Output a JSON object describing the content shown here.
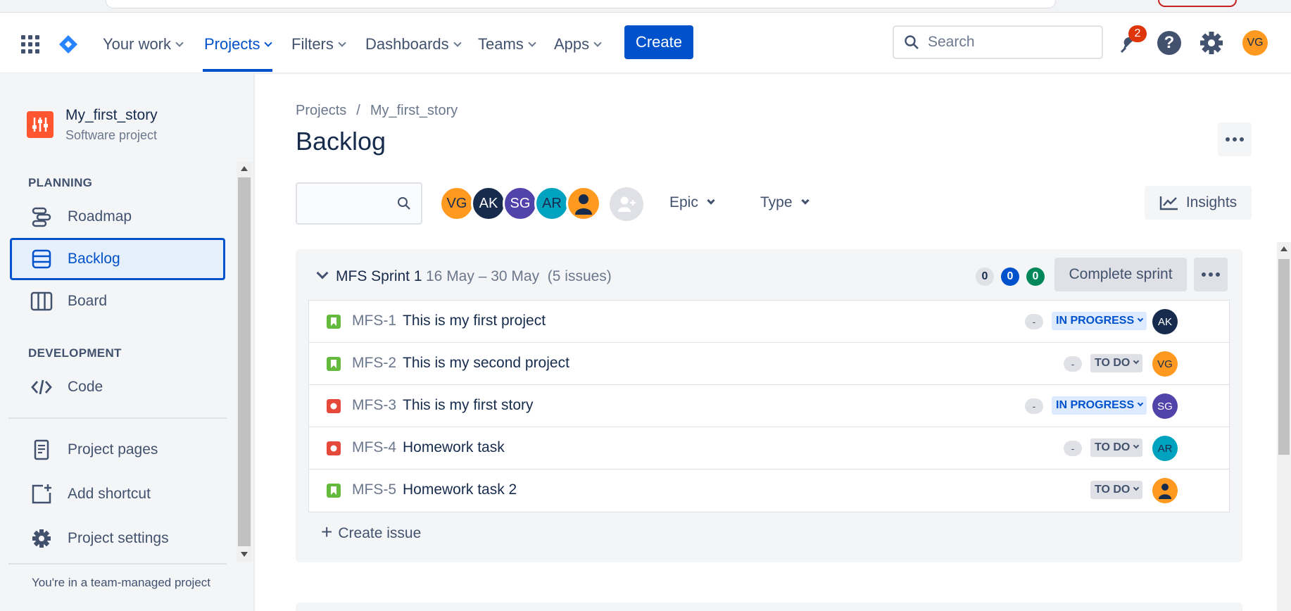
{
  "nav": {
    "items": [
      {
        "label": "Your work"
      },
      {
        "label": "Projects"
      },
      {
        "label": "Filters"
      },
      {
        "label": "Dashboards"
      },
      {
        "label": "Teams"
      },
      {
        "label": "Apps"
      }
    ],
    "create_label": "Create",
    "search_placeholder": "Search",
    "notification_count": "2",
    "help_glyph": "?",
    "user_initials": "VG",
    "accent": "#0052cc"
  },
  "sidebar": {
    "project_name": "My_first_story",
    "project_type": "Software project",
    "planning_label": "PLANNING",
    "development_label": "DEVELOPMENT",
    "items": [
      {
        "label": "Roadmap",
        "icon": "roadmap-icon"
      },
      {
        "label": "Backlog",
        "icon": "backlog-icon",
        "active": true
      },
      {
        "label": "Board",
        "icon": "board-icon"
      },
      {
        "label": "Code",
        "icon": "code-icon"
      },
      {
        "label": "Project pages",
        "icon": "page-icon"
      },
      {
        "label": "Add shortcut",
        "icon": "add-shortcut-icon"
      },
      {
        "label": "Project settings",
        "icon": "gear-icon"
      }
    ],
    "footer": "You're in a team-managed project"
  },
  "main": {
    "breadcrumb": {
      "root": "Projects",
      "sep": "/",
      "project": "My_first_story"
    },
    "title": "Backlog",
    "avatars": [
      {
        "initials": "VG",
        "color": "#ff991f"
      },
      {
        "initials": "AK",
        "color": "#172b4d"
      },
      {
        "initials": "SG",
        "color": "#5243aa"
      },
      {
        "initials": "AR",
        "color": "#00a3bf"
      },
      {
        "initials": "",
        "color": "#ff991f",
        "icon": "user-icon"
      }
    ],
    "filters": {
      "epic": "Epic",
      "type": "Type"
    },
    "insights_label": "Insights"
  },
  "sprint": {
    "name": "MFS Sprint 1",
    "dates": "16 May – 30 May",
    "issue_count": "(5 issues)",
    "counts": {
      "todo": "0",
      "in_progress": "0",
      "done": "0"
    },
    "complete_label": "Complete sprint",
    "create_issue_label": "Create issue",
    "issues": [
      {
        "key": "MFS-1",
        "summary": "This is my first project",
        "estimate": "-",
        "status": "IN PROGRESS",
        "assignee": "AK",
        "type": "story"
      },
      {
        "key": "MFS-2",
        "summary": "This is my second project",
        "estimate": "-",
        "status": "TO DO",
        "assignee": "VG",
        "type": "story"
      },
      {
        "key": "MFS-3",
        "summary": "This is my first story",
        "estimate": "-",
        "status": "IN PROGRESS",
        "assignee": "SG",
        "type": "bug"
      },
      {
        "key": "MFS-4",
        "summary": "Homework task",
        "estimate": "-",
        "status": "TO DO",
        "assignee": "AR",
        "type": "bug"
      },
      {
        "key": "MFS-5",
        "summary": "Homework task 2",
        "estimate": "",
        "status": "TO DO",
        "assignee": "",
        "type": "story"
      }
    ]
  }
}
